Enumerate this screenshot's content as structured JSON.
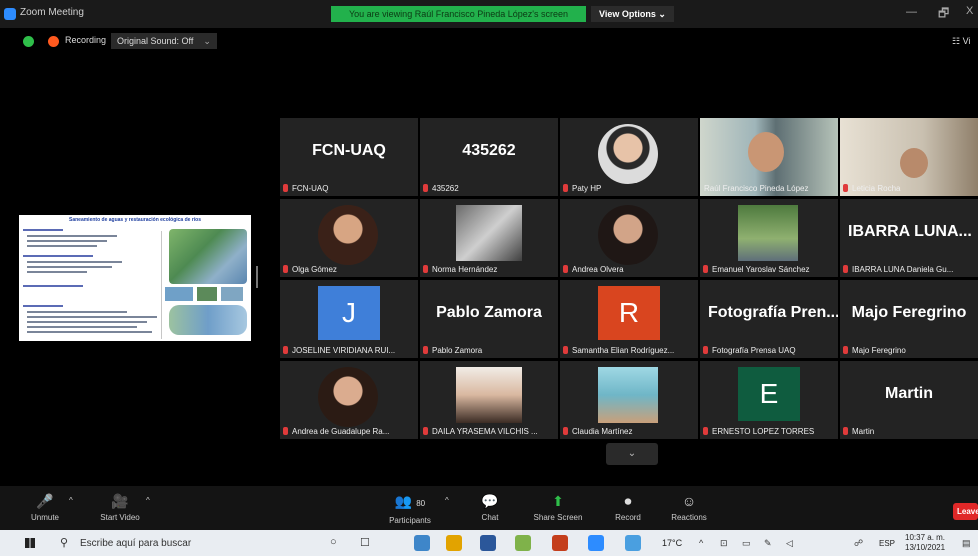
{
  "window": {
    "title": "Zoom Meeting",
    "share_banner": "You are viewing Raúl Francisco Pineda López's screen",
    "view_options": "View Options ⌄",
    "minimize": "—",
    "maximize": "🗗",
    "close": "X"
  },
  "recording": {
    "label": "Recording",
    "original_sound": "Original Sound: Off",
    "caret": "⌄",
    "view_mode": "☷ Vi"
  },
  "slide": {
    "title": "Saneamiento de aguas y restauración ecológica de ríos"
  },
  "tiles": [
    {
      "big": "FCN-UAQ",
      "name": "FCN-UAQ"
    },
    {
      "big": "435262",
      "name": "435262"
    },
    {
      "name": "Paty HP"
    },
    {
      "name": "Raúl Francisco Pineda López"
    },
    {
      "name": "Leticia Rocha"
    },
    {
      "name": "Olga Gómez"
    },
    {
      "name": "Norma Hernández"
    },
    {
      "name": "Andrea Olvera"
    },
    {
      "name": "Emanuel Yaroslav Sánchez"
    },
    {
      "big": "IBARRA LUNA...",
      "name": "IBARRA LUNA Daniela Gu..."
    },
    {
      "letter": "J",
      "name": "JOSELINE VIRIDIANA RUI..."
    },
    {
      "big": "Pablo Zamora",
      "name": "Pablo Zamora"
    },
    {
      "letter": "R",
      "name": "Samantha Elian Rodríguez..."
    },
    {
      "big": "Fotografía Pren...",
      "name": "Fotografía Prensa UAQ"
    },
    {
      "big": "Majo Feregrino",
      "name": "Majo Feregrino"
    },
    {
      "name": "Andrea de Guadalupe Ra..."
    },
    {
      "name": "DAILA YRASEMA VILCHIS ..."
    },
    {
      "name": "Claudia Martínez"
    },
    {
      "letter": "E",
      "name": "ERNESTO LOPEZ TORRES"
    },
    {
      "big": "Martin",
      "name": "Martin"
    }
  ],
  "more_arrow": "⌄",
  "toolbar": {
    "unmute": "Unmute",
    "start_video": "Start Video",
    "participants": "Participants",
    "participants_count": "80",
    "chat": "Chat",
    "share_screen": "Share Screen",
    "record": "Record",
    "reactions": "Reactions",
    "leave": "Leave",
    "caret": "^"
  },
  "taskbar": {
    "search_placeholder": "Escribe aquí para buscar",
    "weather": "17°C",
    "lang": "ESP",
    "time": "10:37 a. m.",
    "date": "13/10/2021"
  },
  "colors": {
    "share_banner": "#22b14c",
    "active_speaker": "#c8e85a",
    "leave": "#e02828",
    "mic_muted": "#e03b3b"
  }
}
